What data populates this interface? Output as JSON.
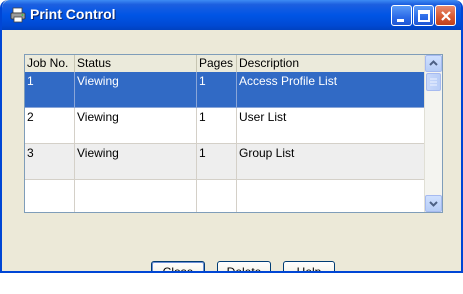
{
  "window": {
    "title": "Print Control"
  },
  "table": {
    "columns": [
      "Job No.",
      "Status",
      "Pages",
      "Description"
    ],
    "rows": [
      {
        "job": "1",
        "status": "Viewing",
        "pages": "1",
        "description": "Access Profile List"
      },
      {
        "job": "2",
        "status": "Viewing",
        "pages": "1",
        "description": "User List"
      },
      {
        "job": "3",
        "status": "Viewing",
        "pages": "1",
        "description": "Group List"
      }
    ]
  },
  "buttons": {
    "close": "Close",
    "delete": "Delete",
    "help": "Help"
  },
  "colors": {
    "selection": "#316ac5",
    "titlebar": "#0055e5"
  }
}
